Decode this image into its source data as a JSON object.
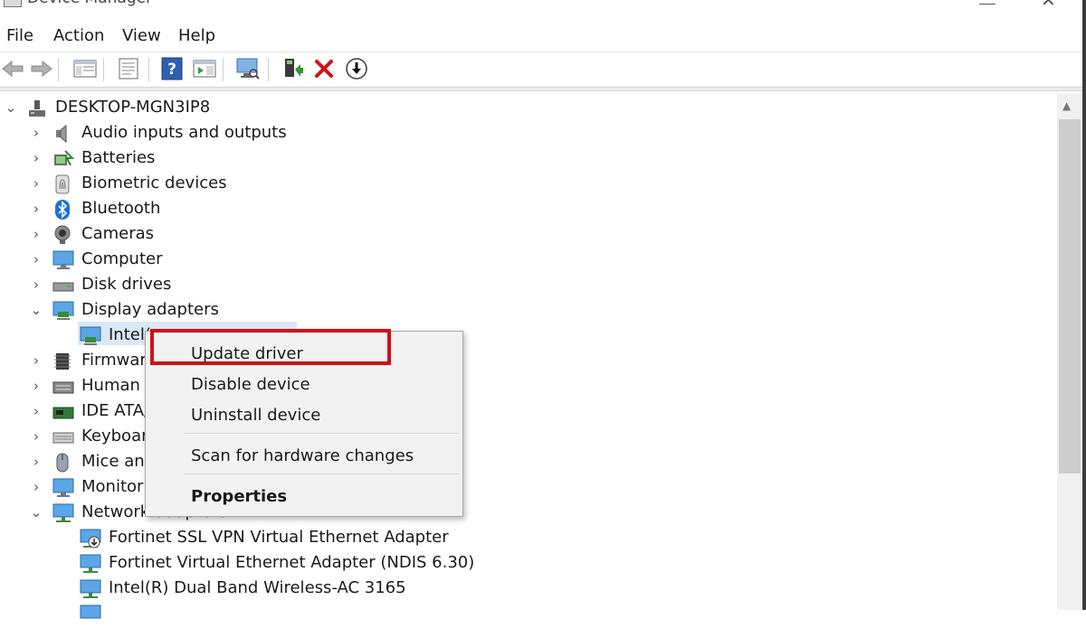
{
  "window": {
    "title": "Device Manager"
  },
  "menu": {
    "items": [
      "File",
      "Action",
      "View",
      "Help"
    ]
  },
  "toolbar": {
    "buttons": [
      "back-icon",
      "forward-icon",
      "show-hide-console-tree-icon",
      "properties-icon",
      "help-icon",
      "action-pane-icon",
      "scan-hardware-icon",
      "update-driver-icon",
      "uninstall-icon",
      "install-legacy-icon"
    ]
  },
  "tree": {
    "root": "DESKTOP-MGN3IP8",
    "items": [
      {
        "label": "Audio inputs and outputs",
        "icon": "speaker-icon"
      },
      {
        "label": "Batteries",
        "icon": "battery-icon"
      },
      {
        "label": "Biometric devices",
        "icon": "fingerprint-icon"
      },
      {
        "label": "Bluetooth",
        "icon": "bluetooth-icon"
      },
      {
        "label": "Cameras",
        "icon": "camera-icon"
      },
      {
        "label": "Computer",
        "icon": "monitor-icon"
      },
      {
        "label": "Disk drives",
        "icon": "disk-icon"
      },
      {
        "label": "Display adapters",
        "icon": "display-adapter-icon"
      },
      {
        "label": "Intel(",
        "icon": "display-adapter-icon"
      },
      {
        "label": "Firmware",
        "icon": "firmware-icon"
      },
      {
        "label": "Human I",
        "icon": "hid-icon"
      },
      {
        "label": "IDE ATA/",
        "icon": "ide-icon"
      },
      {
        "label": "Keyboar",
        "icon": "keyboard-icon"
      },
      {
        "label": "Mice and",
        "icon": "mouse-icon"
      },
      {
        "label": "Monitor",
        "icon": "monitor-icon"
      },
      {
        "label": "Network adapters",
        "icon": "network-icon"
      },
      {
        "label": "Fortinet SSL VPN Virtual Ethernet Adapter",
        "icon": "network-adapter-icon"
      },
      {
        "label": "Fortinet Virtual Ethernet Adapter (NDIS 6.30)",
        "icon": "network-adapter-icon"
      },
      {
        "label": "Intel(R) Dual Band Wireless-AC 3165",
        "icon": "network-adapter-icon"
      }
    ]
  },
  "context_menu": {
    "items": [
      "Update driver",
      "Disable device",
      "Uninstall device",
      "Scan for hardware changes",
      "Properties"
    ],
    "highlight_color": "#d0101a"
  }
}
